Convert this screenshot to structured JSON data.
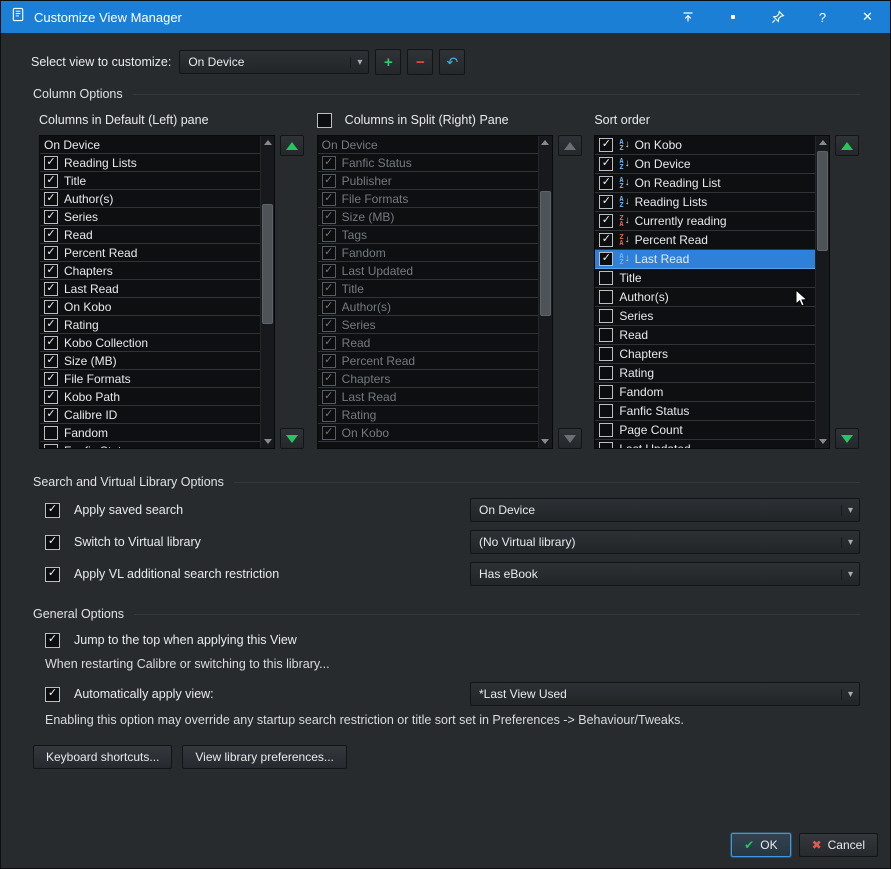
{
  "window": {
    "title": "Customize View Manager"
  },
  "colors": {
    "titlebar": "#1b7fd6",
    "selection": "#2e80d9",
    "green": "#27c460",
    "red": "#e74c3c",
    "teal": "#3fb4d8",
    "ok_border": "#3f96e0"
  },
  "icons": {
    "add": "+",
    "remove": "−",
    "undo": "↶",
    "chevron": "▾",
    "help": "?",
    "close": "✕",
    "ok_check": "✔",
    "cancel_x": "✖"
  },
  "toolbar": {
    "select_view_label": "Select view to customize:",
    "view_value": "On Device"
  },
  "sections": {
    "column_options": "Column Options",
    "search_vl": "Search and Virtual Library Options",
    "general": "General Options"
  },
  "left_pane": {
    "header": "Columns in Default (Left) pane",
    "items": [
      {
        "label": "On Device"
      },
      {
        "label": "Reading Lists",
        "checked": true
      },
      {
        "label": "Title",
        "checked": true
      },
      {
        "label": "Author(s)",
        "checked": true
      },
      {
        "label": "Series",
        "checked": true
      },
      {
        "label": "Read",
        "checked": true
      },
      {
        "label": "Percent Read",
        "checked": true
      },
      {
        "label": "Chapters",
        "checked": true
      },
      {
        "label": "Last Read",
        "checked": true
      },
      {
        "label": "On Kobo",
        "checked": true
      },
      {
        "label": "Rating",
        "checked": true
      },
      {
        "label": "Kobo Collection",
        "checked": true
      },
      {
        "label": "Size (MB)",
        "checked": true
      },
      {
        "label": "File Formats",
        "checked": true
      },
      {
        "label": "Kobo Path",
        "checked": true
      },
      {
        "label": "Calibre ID",
        "checked": true
      },
      {
        "label": "Fandom",
        "checked": false
      },
      {
        "label": "Fanfic Status",
        "checked": false
      }
    ]
  },
  "split_pane": {
    "header": "Columns in Split (Right) Pane",
    "header_checked": false,
    "items": [
      {
        "label": "On Device"
      },
      {
        "label": "Fanfic Status",
        "checked": true
      },
      {
        "label": "Publisher",
        "checked": true
      },
      {
        "label": "File Formats",
        "checked": true
      },
      {
        "label": "Size (MB)",
        "checked": true
      },
      {
        "label": "Tags",
        "checked": true
      },
      {
        "label": "Fandom",
        "checked": true
      },
      {
        "label": "Last Updated",
        "checked": true
      },
      {
        "label": "Title",
        "checked": true
      },
      {
        "label": "Author(s)",
        "checked": true
      },
      {
        "label": "Series",
        "checked": true
      },
      {
        "label": "Read",
        "checked": true
      },
      {
        "label": "Percent Read",
        "checked": true
      },
      {
        "label": "Chapters",
        "checked": true
      },
      {
        "label": "Last Read",
        "checked": true
      },
      {
        "label": "Rating",
        "checked": true
      },
      {
        "label": "On Kobo",
        "checked": true
      }
    ]
  },
  "sort_pane": {
    "header": "Sort order",
    "items": [
      {
        "label": "On Kobo",
        "checked": true,
        "sort": "asc"
      },
      {
        "label": "On Device",
        "checked": true,
        "sort": "asc"
      },
      {
        "label": "On Reading List",
        "checked": true,
        "sort": "asc"
      },
      {
        "label": "Reading Lists",
        "checked": true,
        "sort": "asc"
      },
      {
        "label": "Currently reading",
        "checked": true,
        "sort": "desc"
      },
      {
        "label": "Percent Read",
        "checked": true,
        "sort": "desc"
      },
      {
        "label": "Last Read",
        "checked": true,
        "sort": "asc",
        "selected": true
      },
      {
        "label": "Title",
        "checked": false
      },
      {
        "label": "Author(s)",
        "checked": false
      },
      {
        "label": "Series",
        "checked": false
      },
      {
        "label": "Read",
        "checked": false
      },
      {
        "label": "Chapters",
        "checked": false
      },
      {
        "label": "Rating",
        "checked": false
      },
      {
        "label": "Fandom",
        "checked": false
      },
      {
        "label": "Fanfic Status",
        "checked": false
      },
      {
        "label": "Page Count",
        "checked": false
      },
      {
        "label": "Last Updated",
        "checked": false
      }
    ]
  },
  "search_options": {
    "rows": [
      {
        "label": "Apply saved search",
        "checked": true,
        "value": "On Device"
      },
      {
        "label": "Switch to Virtual library",
        "checked": true,
        "value": "(No Virtual library)"
      },
      {
        "label": "Apply VL additional search restriction",
        "checked": true,
        "value": "Has eBook"
      }
    ]
  },
  "general_options": {
    "jump_label": "Jump to the top when applying this View",
    "jump_checked": true,
    "restart_note": "When restarting Calibre or switching to this library...",
    "auto_apply_label": "Automatically apply view:",
    "auto_apply_checked": true,
    "auto_apply_value": "*Last View Used",
    "override_note": "Enabling this option may override any startup search restriction or title sort set in Preferences -> Behaviour/Tweaks."
  },
  "footer": {
    "keyboard": "Keyboard shortcuts...",
    "view_prefs": "View library preferences...",
    "ok": "OK",
    "cancel": "Cancel"
  }
}
